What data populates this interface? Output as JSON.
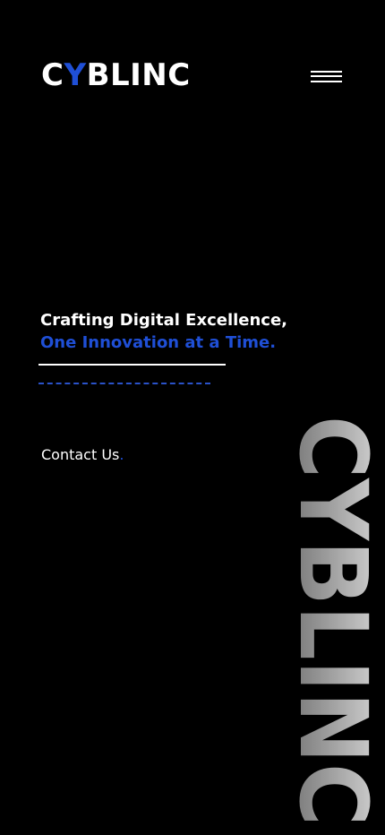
{
  "header": {
    "logo_first": "C",
    "logo_accent": "Y",
    "logo_rest": "BLINC",
    "menu_icon": "hamburger-menu-icon"
  },
  "hero": {
    "headline_line1": "Crafting Digital Excellence,",
    "headline_line2": "One Innovation at a Time.",
    "contact_label": "Contact Us",
    "contact_suffix": "."
  },
  "watermark": {
    "text": "CYBLINC"
  },
  "colors": {
    "background": "#000000",
    "accent": "#1f4fd6",
    "text": "#ffffff",
    "watermark_top": "#d9d9d9",
    "watermark_bottom": "#6b6b6b"
  }
}
